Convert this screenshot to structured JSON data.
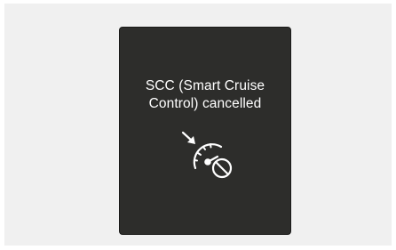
{
  "display": {
    "message": "SCC (Smart Cruise\nControl) cancelled",
    "icon": "scc-cancelled-icon",
    "background_color": "#2d2d2b",
    "text_color": "#ffffff",
    "outer_background_color": "#f0f0f0"
  }
}
